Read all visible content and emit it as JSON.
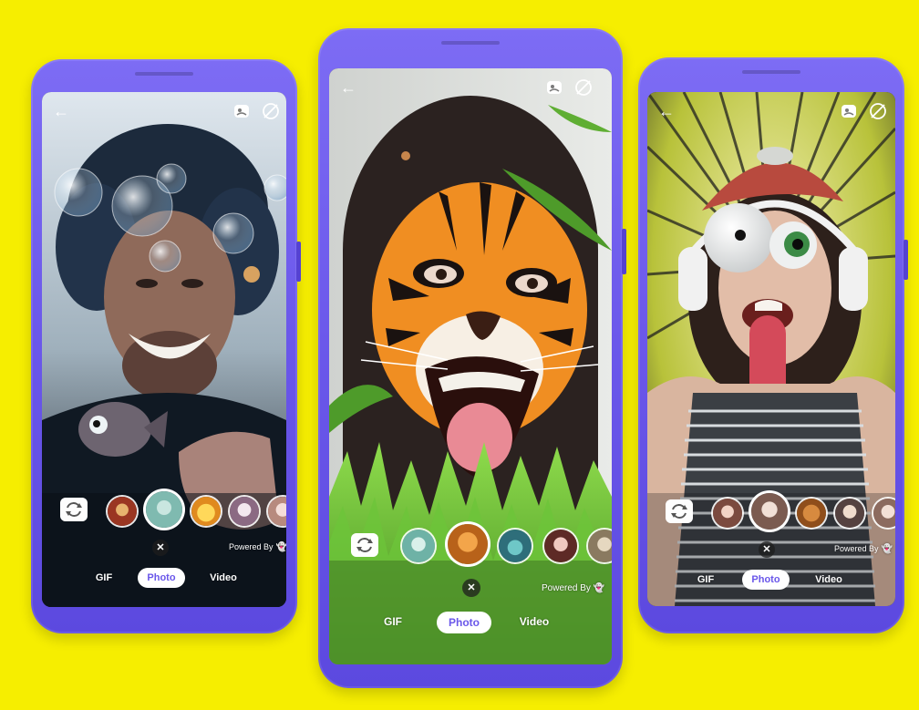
{
  "colors": {
    "background": "#f6ee00",
    "phone_body": "#6a57ea",
    "active_mode_text": "#6a57ea"
  },
  "phones": [
    {
      "id": "left",
      "icons": {
        "back": "arrow-left-icon",
        "sticker": "sticker-icon",
        "flash": "flash-off-icon",
        "switch": "switch-camera-icon"
      },
      "powered_by": "Powered By",
      "modes": {
        "gif": "GIF",
        "photo": "Photo",
        "video": "Video"
      },
      "selected_mode": "Photo",
      "close": "✕"
    },
    {
      "id": "center",
      "icons": {
        "back": "arrow-left-icon",
        "sticker": "sticker-icon",
        "flash": "flash-off-icon",
        "switch": "switch-camera-icon"
      },
      "powered_by": "Powered By",
      "modes": {
        "gif": "GIF",
        "photo": "Photo",
        "video": "Video"
      },
      "selected_mode": "Photo",
      "close": "✕"
    },
    {
      "id": "right",
      "icons": {
        "back": "arrow-left-icon",
        "sticker": "sticker-icon",
        "flash": "flash-off-icon",
        "switch": "switch-camera-icon"
      },
      "powered_by": "Powered By",
      "modes": {
        "gif": "GIF",
        "photo": "Photo",
        "video": "Video"
      },
      "selected_mode": "Photo",
      "close": "✕"
    }
  ]
}
